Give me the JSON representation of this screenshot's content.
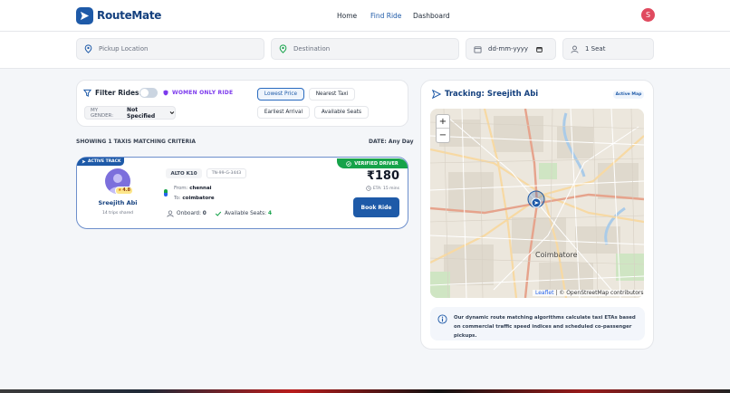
{
  "nav": {
    "brand": "RouteMate",
    "links": [
      "Home",
      "Find Ride",
      "Dashboard"
    ],
    "active": "Find Ride",
    "avatar_initial": "S"
  },
  "search": {
    "pickup_placeholder": "Pickup Location",
    "destination_placeholder": "Destination",
    "date_placeholder": "dd-mm-yyyy",
    "seats": "1 Seat"
  },
  "filters": {
    "title": "Filter Rides:",
    "women_only": "WOMEN ONLY RIDE",
    "gender_label": "MY GENDER:",
    "gender_value": "Not Specified",
    "sort_options": [
      "Lowest Price",
      "Nearest Taxi",
      "Earliest Arrival",
      "Available Seats"
    ],
    "active_sort": "Lowest Price"
  },
  "results": {
    "count_text": "SHOWING 1 TAXIS MATCHING CRITERIA",
    "date_text": "DATE: Any Day"
  },
  "ride": {
    "active_track": "ACTIVE TRACK",
    "verified": "VERIFIED DRIVER",
    "rating": "4.8",
    "driver_name": "Sreejith Abi",
    "trips": "14 trips shared",
    "car_model": "ALTO K10",
    "plate": "TN-99-G-3443",
    "from_label": "From:",
    "from_value": "chennai",
    "to_label": "To:",
    "to_value": "coimbatore",
    "onboard_label": "Onboard:",
    "onboard_value": "0",
    "seats_label": "Available Seats:",
    "seats_value": "4",
    "price": "₹180",
    "eta": "ETA: 15 mins",
    "book_label": "Book Ride"
  },
  "tracking": {
    "title": "Tracking: Sreejith Abi",
    "badge": "Active Map",
    "zoom_in": "+",
    "zoom_out": "−",
    "city_label": "Coimbatore",
    "attribution_leaflet": "Leaflet",
    "attribution_rest": "| © OpenStreetMap contributors",
    "note": "Our dynamic route matching algorithms calculate taxi ETAs based on commercial traffic speed indices and scheduled co-passenger pickups."
  },
  "colors": {
    "primary": "#1e5aa8",
    "accent_purple": "#7c3aed",
    "verified": "#16a34a"
  }
}
